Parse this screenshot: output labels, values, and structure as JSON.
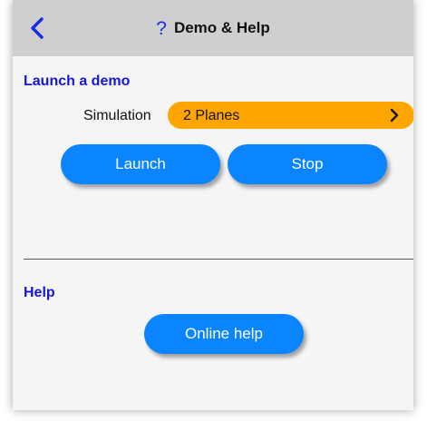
{
  "header": {
    "back_icon": "chevron-left-icon",
    "help_glyph": "?",
    "title": "Demo & Help"
  },
  "launch_section": {
    "title": "Launch a demo",
    "simulation_label": "Simulation",
    "simulation_value": "2 Planes",
    "launch_label": "Launch",
    "stop_label": "Stop"
  },
  "help_section": {
    "title": "Help",
    "online_help_label": "Online help"
  },
  "colors": {
    "header_bg": "#cfcfcf",
    "accent_blue": "#0a84ff",
    "section_title": "#1616d8",
    "select_orange": "#ffa500"
  }
}
